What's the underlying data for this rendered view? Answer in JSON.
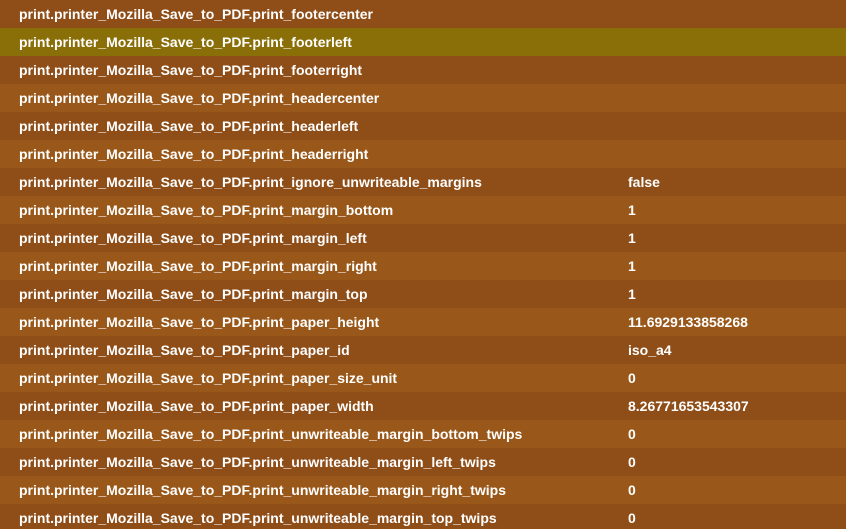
{
  "prefs": [
    {
      "name": "print.printer_Mozilla_Save_to_PDF.print_footercenter",
      "value": ""
    },
    {
      "name": "print.printer_Mozilla_Save_to_PDF.print_footerleft",
      "value": "",
      "selected": true
    },
    {
      "name": "print.printer_Mozilla_Save_to_PDF.print_footerright",
      "value": ""
    },
    {
      "name": "print.printer_Mozilla_Save_to_PDF.print_headercenter",
      "value": ""
    },
    {
      "name": "print.printer_Mozilla_Save_to_PDF.print_headerleft",
      "value": ""
    },
    {
      "name": "print.printer_Mozilla_Save_to_PDF.print_headerright",
      "value": ""
    },
    {
      "name": "print.printer_Mozilla_Save_to_PDF.print_ignore_unwriteable_margins",
      "value": "false"
    },
    {
      "name": "print.printer_Mozilla_Save_to_PDF.print_margin_bottom",
      "value": "1"
    },
    {
      "name": "print.printer_Mozilla_Save_to_PDF.print_margin_left",
      "value": "1"
    },
    {
      "name": "print.printer_Mozilla_Save_to_PDF.print_margin_right",
      "value": "1"
    },
    {
      "name": "print.printer_Mozilla_Save_to_PDF.print_margin_top",
      "value": "1"
    },
    {
      "name": "print.printer_Mozilla_Save_to_PDF.print_paper_height",
      "value": "11.6929133858268"
    },
    {
      "name": "print.printer_Mozilla_Save_to_PDF.print_paper_id",
      "value": "iso_a4"
    },
    {
      "name": "print.printer_Mozilla_Save_to_PDF.print_paper_size_unit",
      "value": "0"
    },
    {
      "name": "print.printer_Mozilla_Save_to_PDF.print_paper_width",
      "value": "8.26771653543307"
    },
    {
      "name": "print.printer_Mozilla_Save_to_PDF.print_unwriteable_margin_bottom_twips",
      "value": "0"
    },
    {
      "name": "print.printer_Mozilla_Save_to_PDF.print_unwriteable_margin_left_twips",
      "value": "0"
    },
    {
      "name": "print.printer_Mozilla_Save_to_PDF.print_unwriteable_margin_right_twips",
      "value": "0"
    },
    {
      "name": "print.printer_Mozilla_Save_to_PDF.print_unwriteable_margin_top_twips",
      "value": "0"
    }
  ],
  "colors": {
    "background": "#8f4d17",
    "row_alt": "#995819",
    "selected": "#8a6f08",
    "text": "#ffffff"
  }
}
